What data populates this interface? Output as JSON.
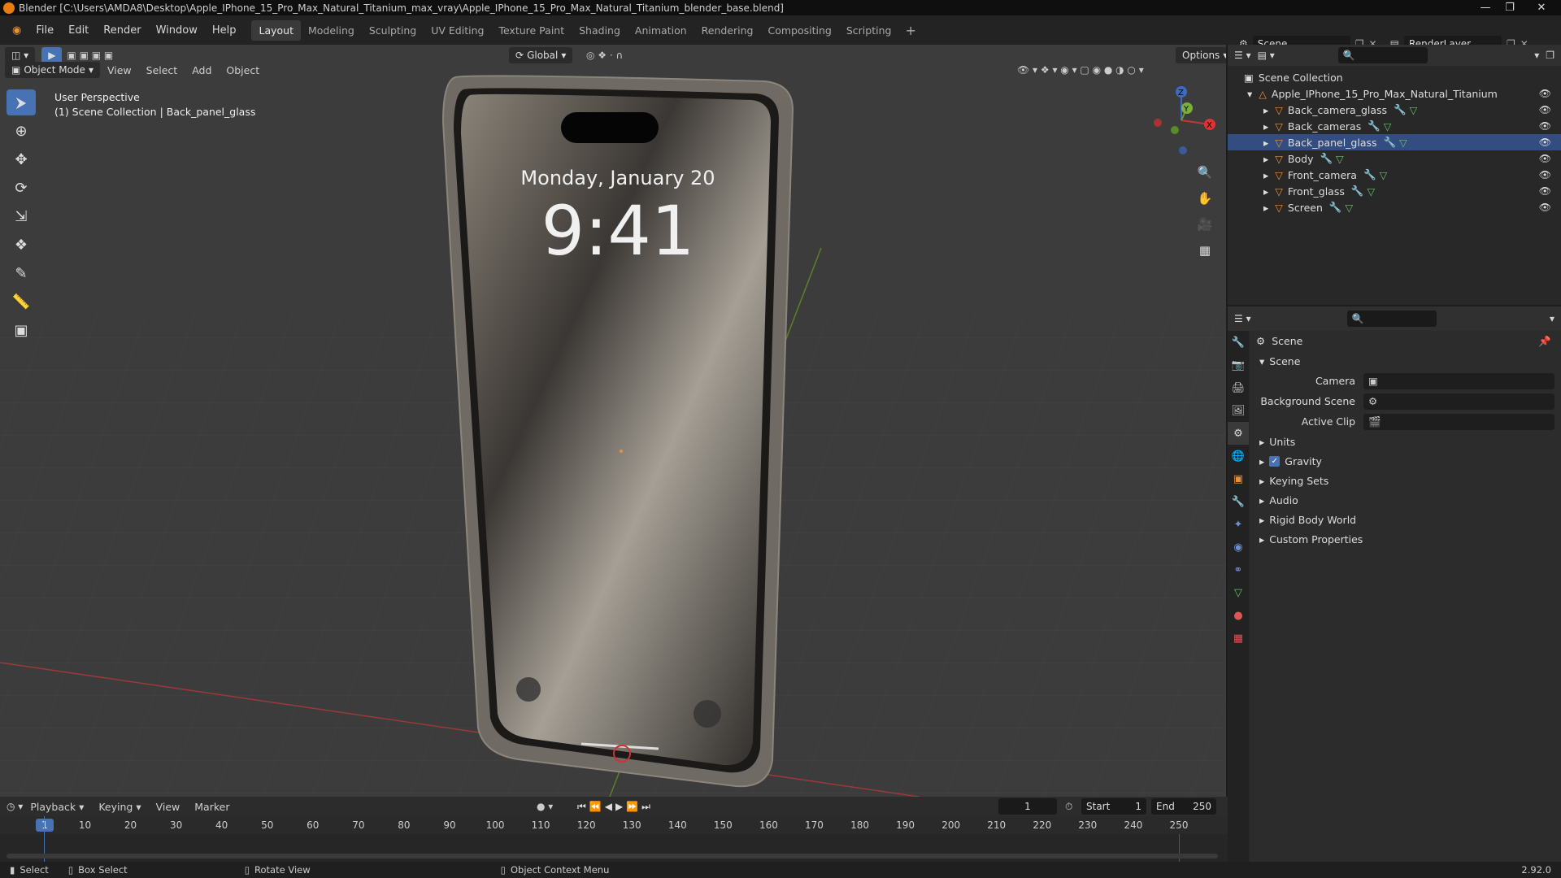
{
  "window": {
    "title": "Blender [C:\\Users\\AMDA8\\Desktop\\Apple_IPhone_15_Pro_Max_Natural_Titanium_max_vray\\Apple_IPhone_15_Pro_Max_Natural_Titanium_blender_base.blend]"
  },
  "menu": [
    "File",
    "Edit",
    "Render",
    "Window",
    "Help"
  ],
  "workspaces": [
    "Layout",
    "Modeling",
    "Sculpting",
    "UV Editing",
    "Texture Paint",
    "Shading",
    "Animation",
    "Rendering",
    "Compositing",
    "Scripting"
  ],
  "active_workspace": "Layout",
  "scene_field": "Scene",
  "renderlayer_field": "RenderLayer",
  "viewport_header": {
    "mode": "Object Mode",
    "menus": [
      "View",
      "Select",
      "Add",
      "Object"
    ],
    "orientation": "Global",
    "options": "Options"
  },
  "viewport_info": {
    "line1": "User Perspective",
    "line2": "(1) Scene Collection | Back_panel_glass"
  },
  "phone_screen": {
    "date": "Monday, January 20",
    "time": "9:41"
  },
  "outliner": {
    "root": "Scene Collection",
    "collection": "Apple_IPhone_15_Pro_Max_Natural_Titanium",
    "objects": [
      "Back_camera_glass",
      "Back_cameras",
      "Back_panel_glass",
      "Body",
      "Front_camera",
      "Front_glass",
      "Screen"
    ]
  },
  "properties": {
    "header": "Scene",
    "section": "Scene",
    "fields": [
      {
        "label": "Camera",
        "value": ""
      },
      {
        "label": "Background Scene",
        "value": ""
      },
      {
        "label": "Active Clip",
        "value": ""
      }
    ],
    "panels": [
      "Units",
      "Gravity",
      "Keying Sets",
      "Audio",
      "Rigid Body World",
      "Custom Properties"
    ]
  },
  "timeline": {
    "menus": [
      "Playback",
      "Keying",
      "View",
      "Marker"
    ],
    "current_frame": "1",
    "start_label": "Start",
    "start": "1",
    "end_label": "End",
    "end": "250",
    "ruler": [
      "1",
      "10",
      "20",
      "30",
      "40",
      "50",
      "60",
      "70",
      "80",
      "90",
      "100",
      "110",
      "120",
      "130",
      "140",
      "150",
      "160",
      "170",
      "180",
      "190",
      "200",
      "210",
      "220",
      "230",
      "240",
      "250"
    ]
  },
  "statusbar": {
    "select": "Select",
    "box_select": "Box Select",
    "rotate_view": "Rotate View",
    "context_menu": "Object Context Menu",
    "version": "2.92.0"
  },
  "colors": {
    "accent": "#4772b3",
    "object_orange": "#e8913b",
    "mesh_green": "#6ac06a"
  }
}
